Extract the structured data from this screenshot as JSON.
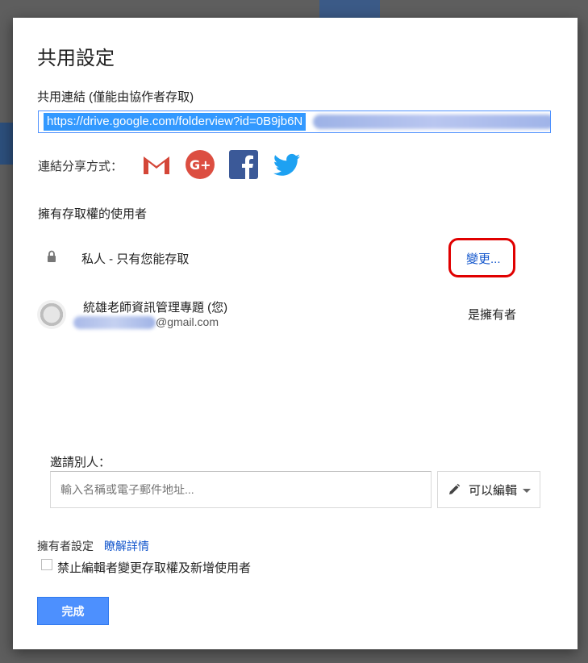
{
  "dialog": {
    "title": "共用設定",
    "link_label": "共用連結 (僅能由協作者存取)",
    "link_value": "https://drive.google.com/folderview?id=0B9jb6N",
    "share_label": "連結分享方式：",
    "share_icons": [
      "gmail-icon",
      "google-plus-icon",
      "facebook-icon",
      "twitter-icon"
    ],
    "users_title": "擁有存取權的使用者",
    "access": {
      "text": "私人 - 只有您能存取",
      "change_label": "變更..."
    },
    "owner": {
      "name": "統雄老師資訊管理專題 (您)",
      "email_visible": "@gmail.com",
      "role": "是擁有者"
    },
    "invite": {
      "label": "邀請別人：",
      "placeholder": "輸入名稱或電子郵件地址...",
      "permission": "可以編輯"
    },
    "owner_settings": {
      "label": "擁有者設定",
      "learn_more": "瞭解詳情",
      "checkbox_label": "禁止編輯者變更存取權及新增使用者",
      "checked": false
    },
    "done_label": "完成"
  },
  "colors": {
    "accent": "#4d90fe",
    "link": "#1155cc",
    "annotation": "#e00000"
  }
}
